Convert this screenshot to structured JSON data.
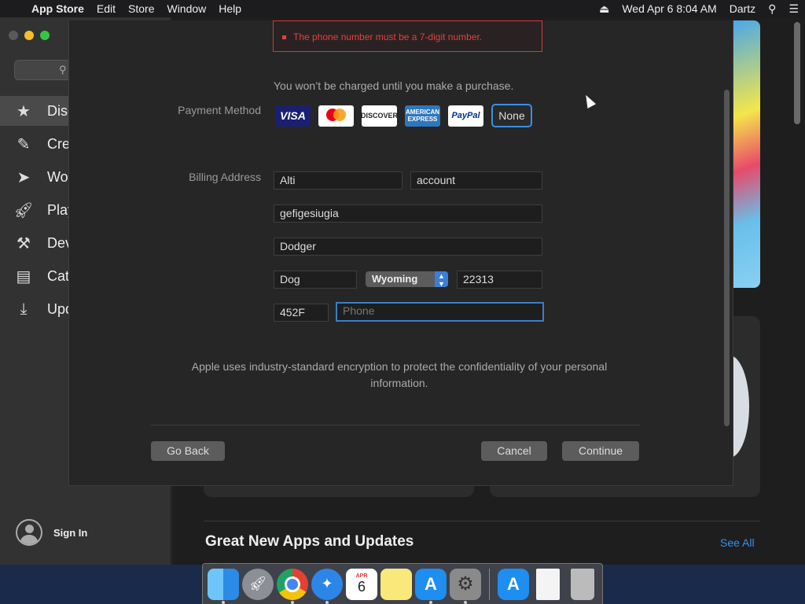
{
  "menubar": {
    "app_name": "App Store",
    "menus": [
      "Edit",
      "Store",
      "Window",
      "Help"
    ],
    "datetime": "Wed Apr 6  8:04 AM",
    "user": "Dartz"
  },
  "sidebar": {
    "items": [
      {
        "label": "Disc",
        "icon": "star-icon"
      },
      {
        "label": "Crea",
        "icon": "brush-icon"
      },
      {
        "label": "Wor",
        "icon": "paper-plane-icon"
      },
      {
        "label": "Play",
        "icon": "rocket-icon"
      },
      {
        "label": "Dev",
        "icon": "hammer-icon"
      },
      {
        "label": "Cate",
        "icon": "categories-icon"
      },
      {
        "label": "Upd",
        "icon": "download-icon"
      }
    ],
    "sign_in": "Sign In"
  },
  "main": {
    "section_title": "Great New Apps and Updates",
    "see_all": "See All"
  },
  "sheet": {
    "error": "The phone number must be a 7-digit number.",
    "charge_note": "You won’t be charged until you make a purchase.",
    "payment_label": "Payment Method",
    "payment_methods": [
      "VISA",
      "mastercard",
      "DISCOVER",
      "AMERICAN EXPRESS",
      "PayPal"
    ],
    "none_label": "None",
    "billing_label": "Billing Address",
    "first_name": "Alti",
    "last_name": "account",
    "street": "gefigesiugia",
    "street2": "Dodger",
    "city": "Dog",
    "state": "Wyoming",
    "zip": "22313",
    "area_code": "452F",
    "phone_placeholder": "Phone",
    "encryption_note": "Apple uses industry-standard encryption to protect the confidentiality of your personal information.",
    "go_back": "Go Back",
    "cancel": "Cancel",
    "continue": "Continue"
  },
  "dock": {
    "calendar_month": "APR",
    "calendar_day": "6"
  }
}
